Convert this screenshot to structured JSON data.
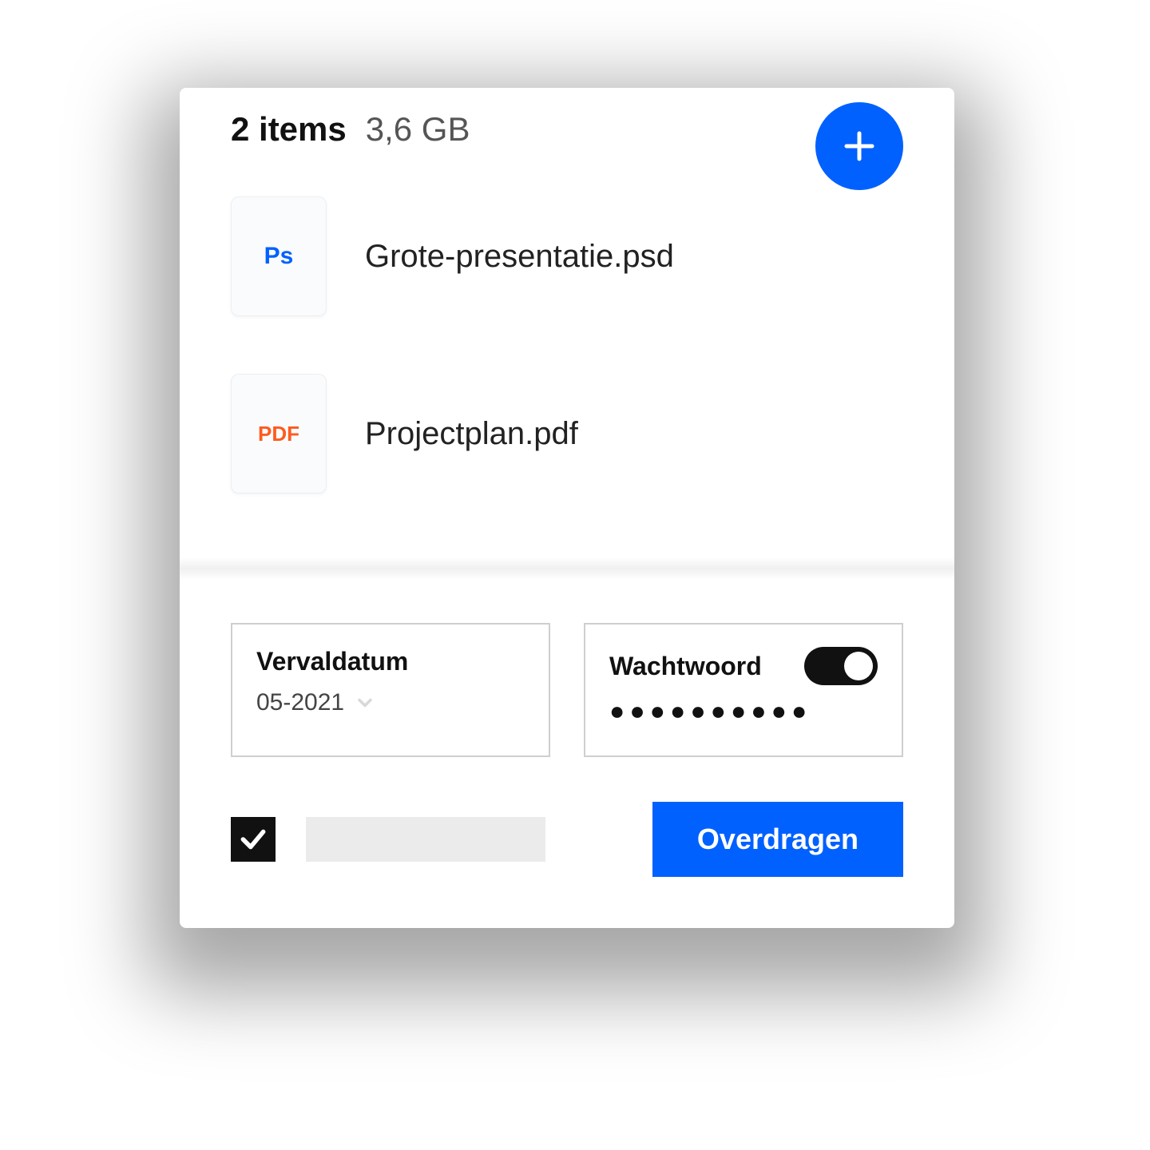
{
  "header": {
    "item_count": "2 items",
    "total_size": "3,6 GB"
  },
  "files": [
    {
      "icon_label": "Ps",
      "icon_class": "ps",
      "name": "Grote-presentatie.psd"
    },
    {
      "icon_label": "PDF",
      "icon_class": "pdf",
      "name": "Projectplan.pdf"
    }
  ],
  "options": {
    "expiry_label": "Vervaldatum",
    "expiry_value": "05-2021",
    "password_label": "Wachtwoord",
    "password_masked": "●●●●●●●●●●"
  },
  "footer": {
    "transfer_label": "Overdragen"
  }
}
